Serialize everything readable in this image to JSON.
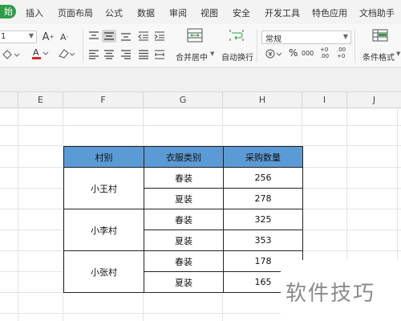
{
  "menu": {
    "start_label": "始",
    "items": [
      "插入",
      "页面布局",
      "公式",
      "数据",
      "审阅",
      "视图",
      "安全",
      "开发工具",
      "特色应用",
      "文档助手"
    ]
  },
  "ribbon": {
    "font_size_value": "1",
    "number_format_value": "常规",
    "merge_center_label": "合并居中",
    "wrap_text_label": "自动换行",
    "cond_format_label": "条件格式",
    "percent_symbol": "%",
    "thousand_symbol": "000",
    "increase_decimal_label": "+0 .00",
    "decrease_decimal_label": ".00 +0"
  },
  "colors": {
    "accent_green": "#2e9e46",
    "header_fill": "#5b9bd5"
  },
  "sheet": {
    "columns": [
      "E",
      "F",
      "G",
      "H",
      "I",
      "J"
    ]
  },
  "table": {
    "headers": [
      "村别",
      "衣服类别",
      "采购数量"
    ],
    "groups": [
      {
        "village": "小王村",
        "rows": [
          {
            "type": "春装",
            "qty": "256"
          },
          {
            "type": "夏装",
            "qty": "278"
          }
        ]
      },
      {
        "village": "小李村",
        "rows": [
          {
            "type": "春装",
            "qty": "325"
          },
          {
            "type": "夏装",
            "qty": "353"
          }
        ]
      },
      {
        "village": "小张村",
        "rows": [
          {
            "type": "春装",
            "qty": "178"
          },
          {
            "type": "夏装",
            "qty": "165"
          }
        ]
      }
    ]
  },
  "watermark": "软件技巧"
}
